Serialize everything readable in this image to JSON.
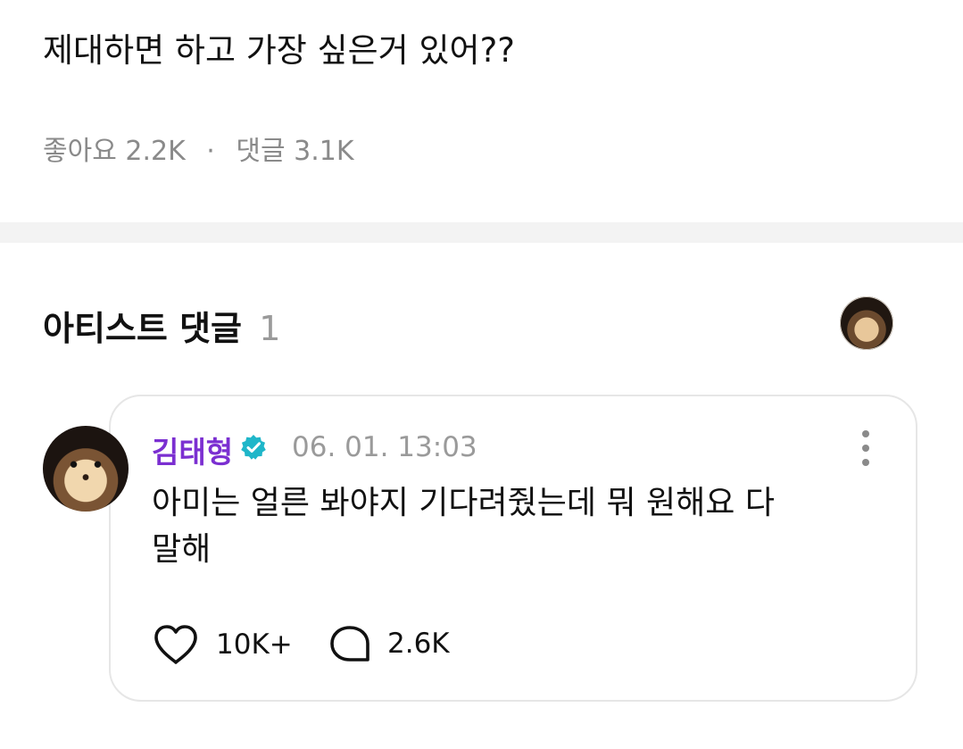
{
  "post": {
    "text": "제대하면 하고 가장 싶은거 있어??",
    "likes_label": "좋아요",
    "likes_count": "2.2K",
    "separator": "·",
    "comments_label": "댓글",
    "comments_count": "3.1K"
  },
  "artist_section": {
    "title": "아티스트 댓글",
    "count": "1"
  },
  "comment": {
    "author": "김태형",
    "verified_icon": "verified-badge-icon",
    "timestamp": "06. 01. 13:03",
    "text_line1": "아미는 얼른 봐야지 기다려줬는데 뭐 원해요 다",
    "text_line2": "말해",
    "like_count": "10K+",
    "reply_count": "2.6K"
  },
  "colors": {
    "author": "#7b2fd1",
    "verified": "#1fb6c9",
    "muted": "#8a8a8a",
    "divider": "#f3f3f3"
  }
}
